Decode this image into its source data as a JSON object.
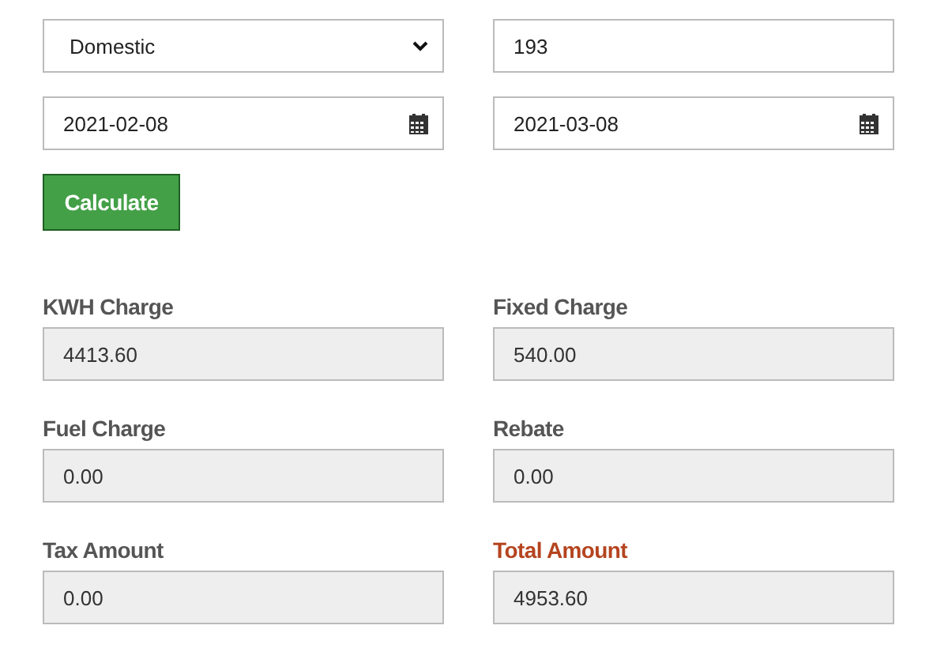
{
  "inputs": [
    {
      "kind": "select",
      "value": "Domestic"
    },
    {
      "kind": "text",
      "value": "193"
    },
    {
      "kind": "date",
      "value": "2021-02-08"
    },
    {
      "kind": "date",
      "value": "2021-03-08"
    }
  ],
  "button": "Calculate",
  "results": [
    {
      "label": "KWH Charge",
      "value": "4413.60",
      "color": "#555555"
    },
    {
      "label": "Fixed Charge",
      "value": "540.00",
      "color": "#555555"
    },
    {
      "label": "Fuel Charge",
      "value": "0.00",
      "color": "#555555"
    },
    {
      "label": "Rebate",
      "value": "0.00",
      "color": "#555555"
    },
    {
      "label": "Tax Amount",
      "value": "0.00",
      "color": "#555555"
    },
    {
      "label": "Total Amount",
      "value": "4953.60",
      "color": "#b5441f"
    }
  ]
}
